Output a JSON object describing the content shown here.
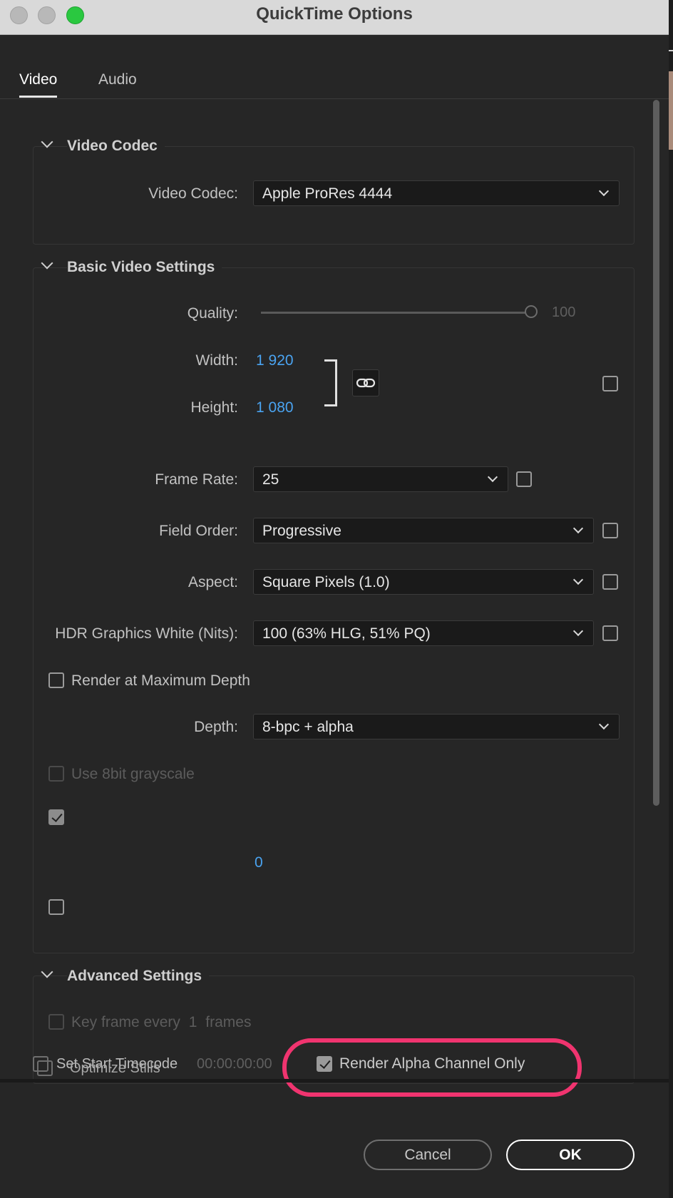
{
  "window": {
    "title": "QuickTime Options"
  },
  "tabs": [
    {
      "label": "Video"
    },
    {
      "label": "Audio"
    }
  ],
  "video_codec_section": {
    "title": "Video Codec",
    "codec_label": "Video Codec:",
    "codec_value": "Apple ProRes 4444"
  },
  "basic_video": {
    "title": "Basic Video Settings",
    "quality_label": "Quality:",
    "quality_value": "100",
    "width_label": "Width:",
    "width_value": "1 920",
    "height_label": "Height:",
    "height_value": "1 080",
    "frame_rate_label": "Frame Rate:",
    "frame_rate_value": "25",
    "field_order_label": "Field Order:",
    "field_order_value": "Progressive",
    "aspect_label": "Aspect:",
    "aspect_value": "Square Pixels (1.0)",
    "hdr_label": "HDR Graphics White (Nits):",
    "hdr_value": "100 (63% HLG, 51% PQ)",
    "render_max_depth_label": "Render at Maximum Depth",
    "depth_label": "Depth:",
    "depth_value": "8-bpc + alpha",
    "grayscale_label": "Use 8bit grayscale",
    "blue_zero": "0"
  },
  "advanced": {
    "title": "Advanced Settings",
    "keyframe_label": "Key frame every",
    "keyframe_count": "1",
    "keyframe_unit": "frames",
    "optimize_stills_label": "Optimize Stills",
    "start_timecode_label": "Set Start Timecode",
    "start_timecode_value": "00:00:00:00",
    "alpha_only_label": "Render Alpha Channel Only"
  },
  "buttons": {
    "cancel": "Cancel",
    "ok": "OK"
  },
  "colors": {
    "accent_blue": "#4aa3f0",
    "highlight": "#f0346f",
    "maximize_green": "#2ac840"
  },
  "icons": {
    "link": "link-icon",
    "chevron": "chevron-down-icon"
  }
}
